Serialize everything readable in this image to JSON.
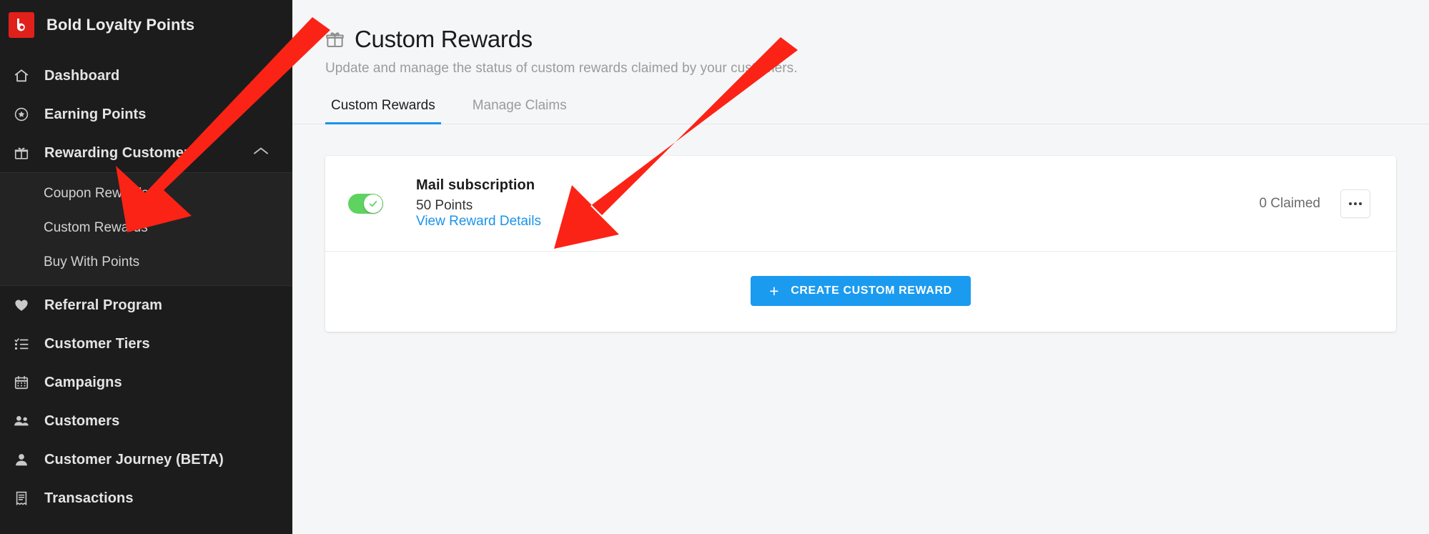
{
  "sidebar": {
    "brand": {
      "name": "Bold Loyalty Points",
      "logo_letter": "b",
      "logo_color": "#e0201b"
    },
    "items": [
      {
        "label": "Dashboard",
        "icon": "home-icon"
      },
      {
        "label": "Earning Points",
        "icon": "star-circle-icon"
      },
      {
        "label": "Rewarding Customers",
        "icon": "gift-icon",
        "expanded": true,
        "chevron": "chevron-up-icon"
      },
      {
        "label": "Referral Program",
        "icon": "heart-icon"
      },
      {
        "label": "Customer Tiers",
        "icon": "checklist-icon"
      },
      {
        "label": "Campaigns",
        "icon": "calendar-icon"
      },
      {
        "label": "Customers",
        "icon": "people-icon"
      },
      {
        "label": "Customer Journey (BETA)",
        "icon": "person-icon"
      },
      {
        "label": "Transactions",
        "icon": "receipt-icon"
      }
    ],
    "submenu": [
      {
        "label": "Coupon Rewards"
      },
      {
        "label": "Custom Rewards"
      },
      {
        "label": "Buy With Points"
      }
    ]
  },
  "main": {
    "title": "Custom Rewards",
    "title_icon": "gift-icon",
    "subtitle": "Update and manage the status of custom rewards claimed by your customers.",
    "tabs": [
      {
        "label": "Custom Rewards",
        "active": true
      },
      {
        "label": "Manage Claims",
        "active": false
      }
    ],
    "accent_color": "#1a9bf0",
    "rewards": [
      {
        "name": "Mail subscription",
        "points": "50 Points",
        "details_link": "View Reward Details",
        "claimed": "0 Claimed",
        "enabled": true,
        "toggle_color": "#5fd35f",
        "menu_icon": "ellipsis-icon"
      }
    ],
    "create_button": {
      "label": "CREATE CUSTOM REWARD",
      "icon": "plus-icon"
    }
  },
  "annotations": {
    "arrow_color": "#fb2316",
    "arrows": [
      {
        "name": "arrow-to-custom-rewards-nav"
      },
      {
        "name": "arrow-to-reward-card"
      }
    ]
  }
}
